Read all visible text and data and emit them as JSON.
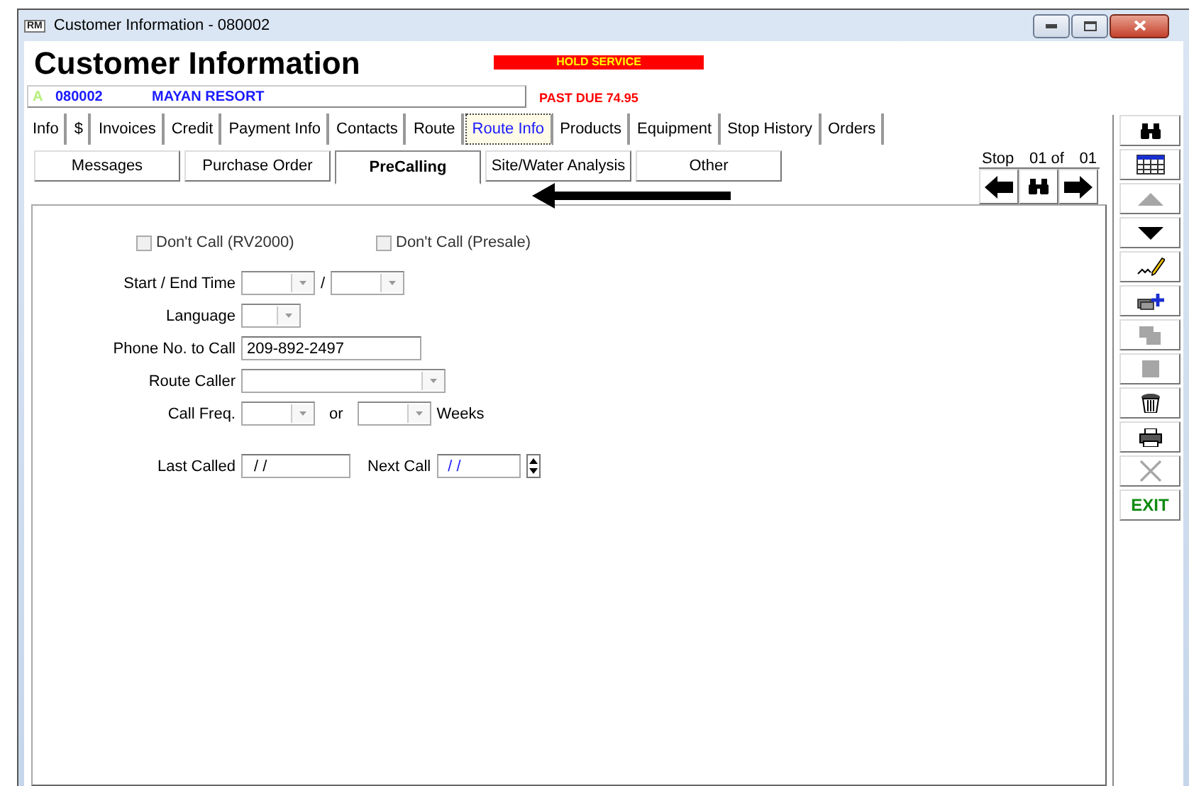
{
  "window": {
    "app_icon": "RM",
    "title": "Customer Information - 080002"
  },
  "header": {
    "title": "Customer Information",
    "alert": "HOLD SERVICE",
    "customer_flag": "A",
    "customer_id": "080002",
    "customer_name": "MAYAN RESORT",
    "past_due": "PAST DUE  74.95"
  },
  "tabs": [
    {
      "label": "Info",
      "selected": false
    },
    {
      "label": "$",
      "selected": false
    },
    {
      "label": "Invoices",
      "selected": false
    },
    {
      "label": "Credit",
      "selected": false
    },
    {
      "label": "Payment Info",
      "selected": false
    },
    {
      "label": "Contacts",
      "selected": false
    },
    {
      "label": "Route",
      "selected": false
    },
    {
      "label": "Route Info",
      "selected": true
    },
    {
      "label": "Products",
      "selected": false
    },
    {
      "label": "Equipment",
      "selected": false
    },
    {
      "label": "Stop History",
      "selected": false
    },
    {
      "label": "Orders",
      "selected": false
    }
  ],
  "subtabs": [
    {
      "label": "Messages",
      "selected": false
    },
    {
      "label": "Purchase Order",
      "selected": false
    },
    {
      "label": "PreCalling",
      "selected": true
    },
    {
      "label": "Site/Water Analysis",
      "selected": false
    },
    {
      "label": "Other",
      "selected": false
    }
  ],
  "stop_nav": {
    "label": "Stop",
    "current": "01 of",
    "total": "01"
  },
  "form": {
    "checkboxes": [
      {
        "label": "Don't Call (RV2000)",
        "checked": false,
        "disabled": true
      },
      {
        "label": "Don't Call (Presale)",
        "checked": false,
        "disabled": true
      }
    ],
    "start_end_time": {
      "label": "Start / End Time",
      "separator": "/"
    },
    "language": {
      "label": "Language"
    },
    "phone": {
      "label": "Phone No. to Call",
      "value": "209-892-2497"
    },
    "route_caller": {
      "label": "Route Caller"
    },
    "call_freq": {
      "label": "Call Freq.",
      "or": "or",
      "unit": "Weeks"
    },
    "last_called": {
      "label": "Last Called",
      "value": "/ /"
    },
    "next_call": {
      "label": "Next Call",
      "value": "/ /"
    }
  },
  "toolbar": [
    {
      "kind": "search",
      "disabled": false
    },
    {
      "kind": "grid",
      "disabled": false
    },
    {
      "kind": "up",
      "disabled": true
    },
    {
      "kind": "down",
      "disabled": false
    },
    {
      "kind": "sign",
      "disabled": false
    },
    {
      "kind": "add",
      "disabled": false
    },
    {
      "kind": "copy",
      "disabled": true
    },
    {
      "kind": "stop",
      "disabled": true
    },
    {
      "kind": "delete",
      "disabled": false
    },
    {
      "kind": "print",
      "disabled": false
    },
    {
      "kind": "cancel",
      "disabled": true
    },
    {
      "kind": "exit",
      "label": "EXIT",
      "disabled": false
    }
  ]
}
